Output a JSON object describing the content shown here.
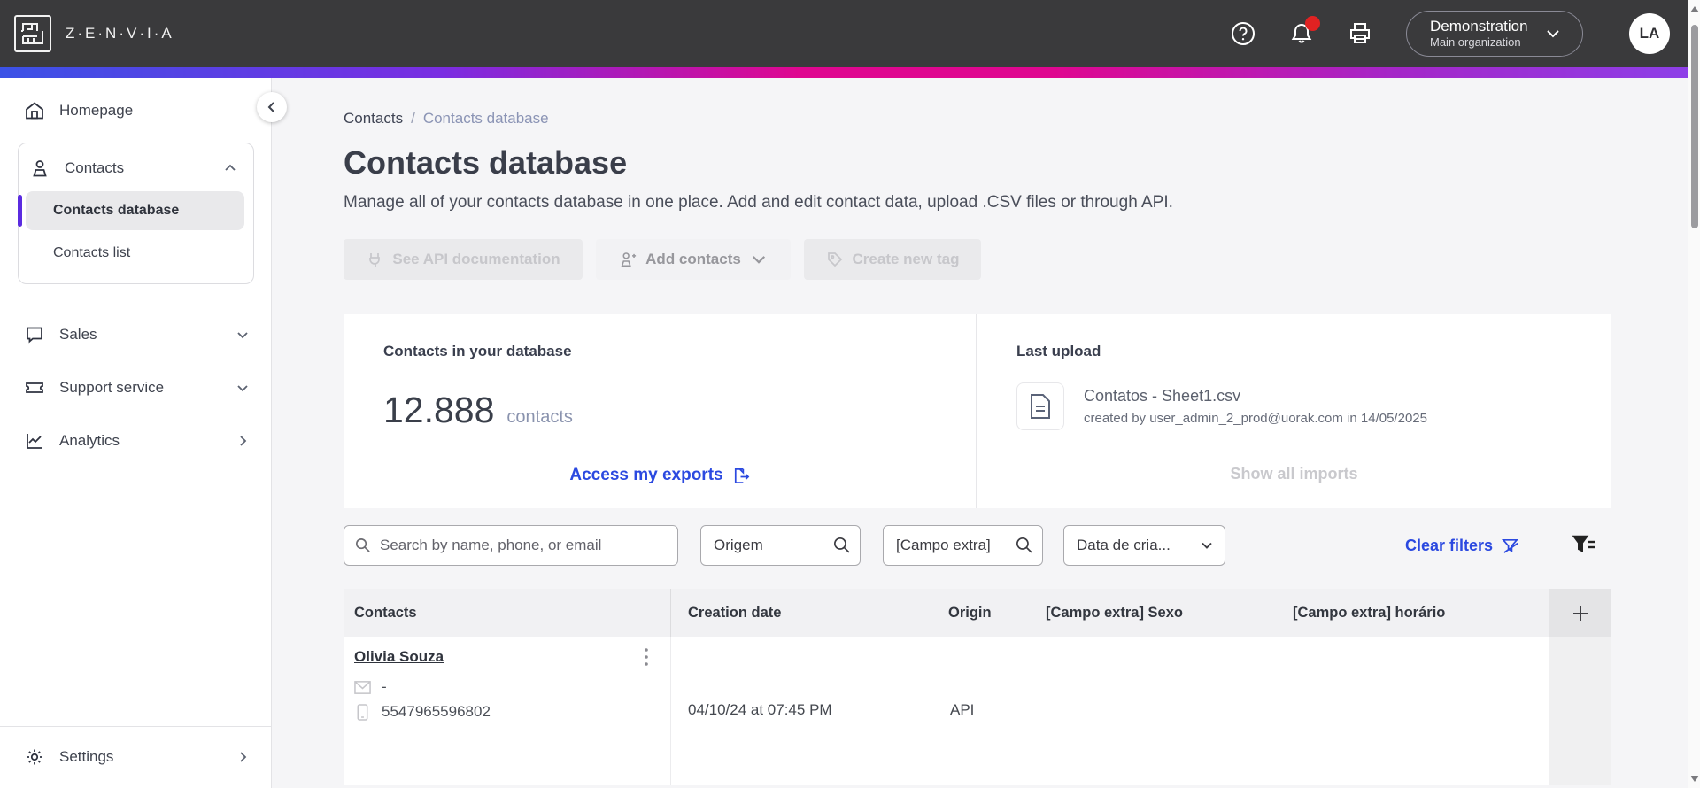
{
  "topbar": {
    "brand": "Z·E·N·V·I·A",
    "org_name": "Demonstration",
    "org_subtitle": "Main organization",
    "avatar_initials": "LA",
    "colors": {
      "bar_bg": "#3a3a3c",
      "badge": "#e02222"
    }
  },
  "gradient": {
    "colors": [
      "#3b52e6",
      "#7a2de2",
      "#df0790",
      "#8c40e9"
    ]
  },
  "sidebar": {
    "items": [
      {
        "label": "Homepage"
      },
      {
        "label": "Contacts"
      },
      {
        "label": "Contacts database",
        "selected": true
      },
      {
        "label": "Contacts list"
      },
      {
        "label": "Sales"
      },
      {
        "label": "Support service"
      },
      {
        "label": "Analytics"
      },
      {
        "label": "Settings"
      }
    ],
    "accent_color": "#5b2be0"
  },
  "breadcrumb": {
    "items": [
      {
        "label": "Contacts"
      },
      {
        "label": "Contacts database"
      }
    ],
    "separator": "/"
  },
  "page": {
    "title": "Contacts database",
    "subtitle": "Manage all of your contacts database in one place. Add and edit contact data, upload .CSV files or through API."
  },
  "actions": {
    "api_docs_label": "See API documentation",
    "add_contacts_label": "Add contacts",
    "create_tag_label": "Create new tag"
  },
  "stats_card": {
    "title": "Contacts in your database",
    "value": "12.888",
    "unit": "contacts",
    "link_label": "Access my exports"
  },
  "upload_card": {
    "title": "Last upload",
    "file_name": "Contatos - Sheet1.csv",
    "file_meta": "created by user_admin_2_prod@uorak.com in 14/05/2025",
    "link_label": "Show all imports"
  },
  "filters": {
    "search_placeholder": "Search by name, phone, or email",
    "origem_label": "Origem",
    "campo_extra_label": "[Campo extra]",
    "date_label": "Data de cria...",
    "clear_label": "Clear filters"
  },
  "table": {
    "headers": [
      "Contacts",
      "Creation date",
      "Origin",
      "[Campo extra] Sexo",
      "[Campo extra] horário"
    ],
    "add_column_label": "+",
    "row": {
      "name": "Olivia Souza",
      "email": "-",
      "phone": "5547965596802",
      "creation_date": "04/10/24 at 07:45 PM",
      "origin": "API"
    }
  },
  "theme": {
    "link_blue": "#2b49e0",
    "page_bg": "#f5f5f7"
  }
}
